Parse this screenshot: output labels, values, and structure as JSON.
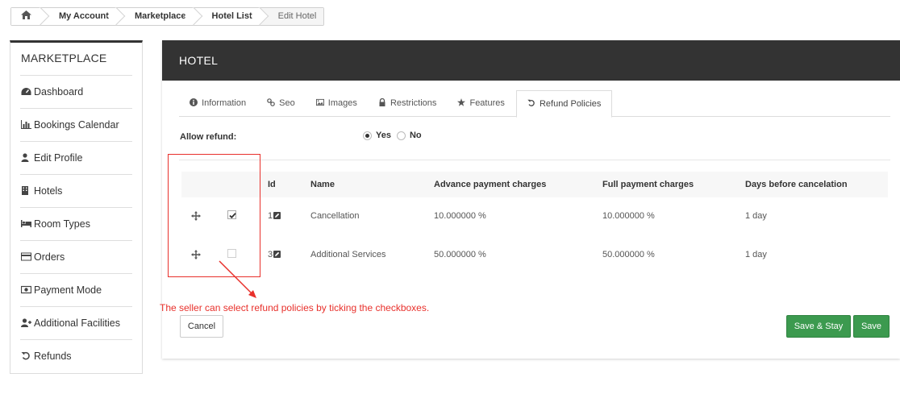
{
  "breadcrumb": {
    "home_icon": "home-icon",
    "items": [
      "My Account",
      "Marketplace",
      "Hotel List",
      "Edit Hotel"
    ]
  },
  "sidebar": {
    "title": "MARKETPLACE",
    "items": [
      {
        "label": "Dashboard",
        "icon": "dashboard-icon"
      },
      {
        "label": "Bookings Calendar",
        "icon": "bar-chart-icon"
      },
      {
        "label": "Edit Profile",
        "icon": "user-icon"
      },
      {
        "label": "Hotels",
        "icon": "building-icon"
      },
      {
        "label": "Room Types",
        "icon": "bed-icon"
      },
      {
        "label": "Orders",
        "icon": "credit-card-icon"
      },
      {
        "label": "Payment Mode",
        "icon": "money-icon"
      },
      {
        "label": "Additional Facilities",
        "icon": "user-plus-icon"
      },
      {
        "label": "Refunds",
        "icon": "undo-icon"
      }
    ]
  },
  "panel": {
    "title": "HOTEL",
    "tabs": [
      {
        "label": "Information",
        "icon": "info-icon"
      },
      {
        "label": "Seo",
        "icon": "link-icon"
      },
      {
        "label": "Images",
        "icon": "image-icon"
      },
      {
        "label": "Restrictions",
        "icon": "lock-icon"
      },
      {
        "label": "Features",
        "icon": "star-icon"
      },
      {
        "label": "Refund Policies",
        "icon": "undo-icon",
        "active": true
      }
    ],
    "allow_refund": {
      "label": "Allow refund:",
      "options": [
        {
          "label": "Yes",
          "selected": true
        },
        {
          "label": "No",
          "selected": false
        }
      ]
    },
    "table": {
      "headers": [
        "Id",
        "Name",
        "Advance payment charges",
        "Full payment charges",
        "Days before cancelation"
      ],
      "rows": [
        {
          "checked": true,
          "id": "1",
          "name": "Cancellation",
          "advance": "10.000000 %",
          "full": "10.000000 %",
          "days": "1 day"
        },
        {
          "checked": false,
          "id": "3",
          "name": "Additional Services",
          "advance": "50.000000 %",
          "full": "50.000000 %",
          "days": "1 day"
        }
      ]
    },
    "buttons": {
      "cancel": "Cancel",
      "save_stay": "Save & Stay",
      "save": "Save"
    }
  },
  "annotation": {
    "text": "The seller can select refund policies by ticking the checkboxes.",
    "color": "#e8302b"
  },
  "colors": {
    "header_bg": "#333333",
    "button_green": "#3c9a4f",
    "annotation_red": "#e8302b"
  }
}
